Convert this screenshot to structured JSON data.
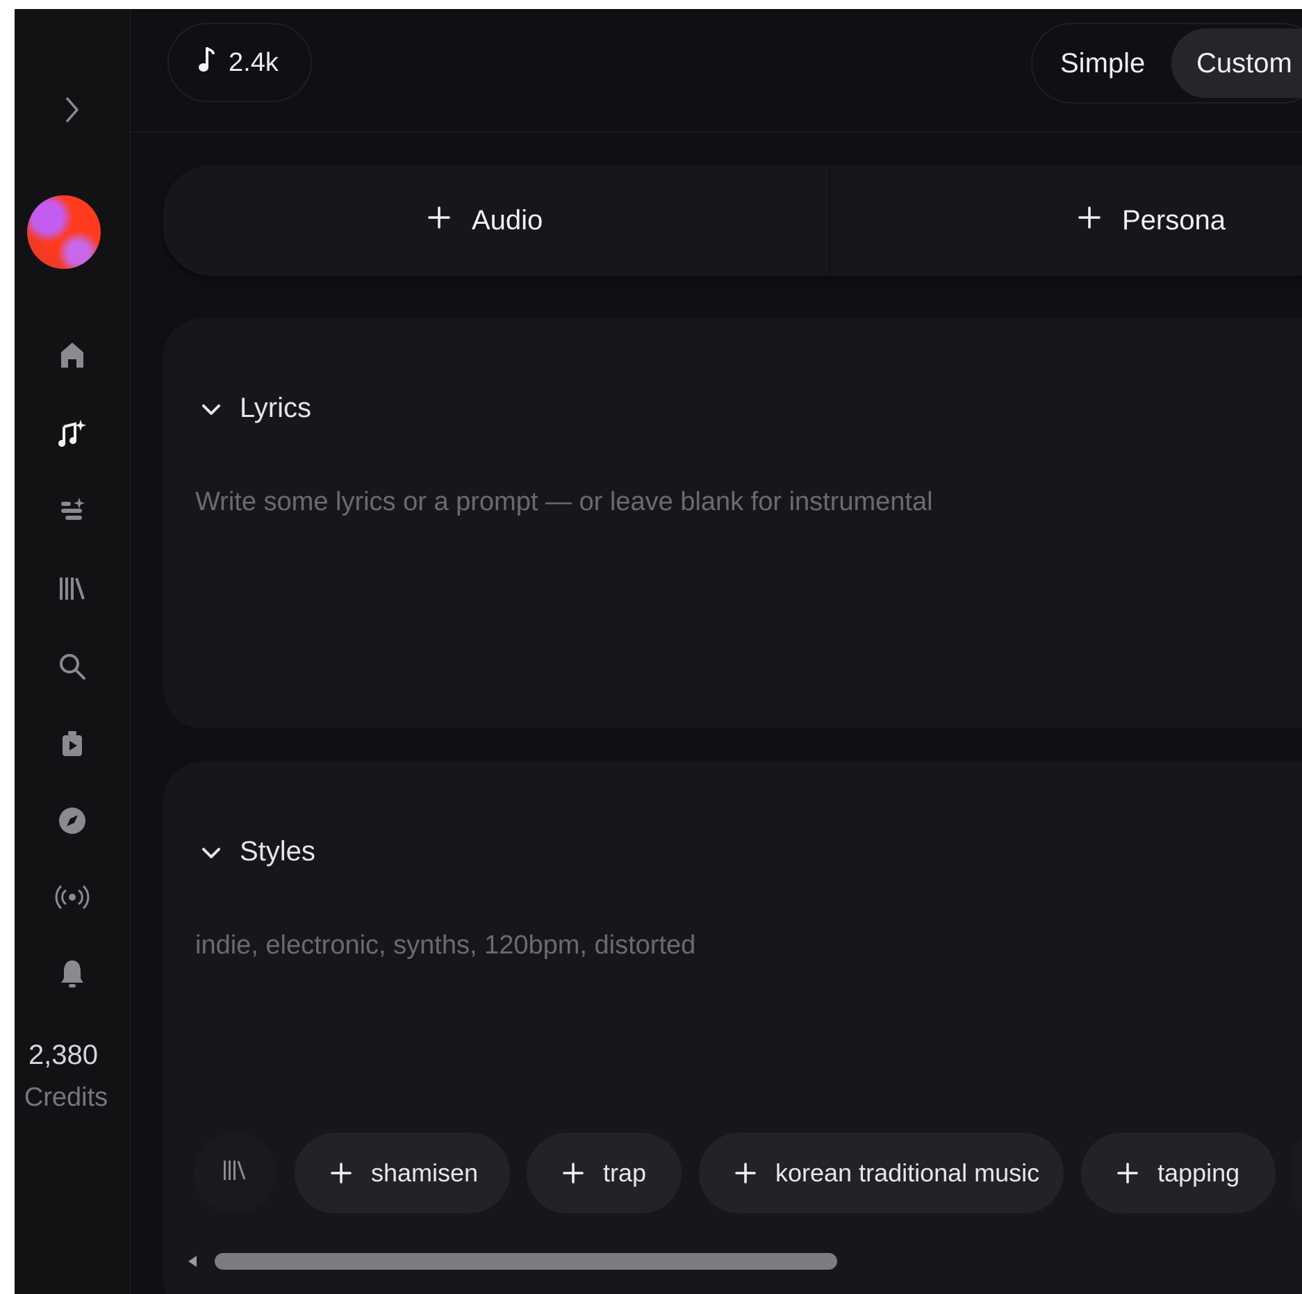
{
  "sidebar": {
    "expand_icon": "chevron-right-icon",
    "nav_icons": [
      "home-icon",
      "create-music-icon",
      "studio-icon",
      "library-icon",
      "search-icon",
      "video-icon",
      "explore-compass-icon",
      "radio-broadcast-icon",
      "notifications-bell-icon"
    ],
    "credits_value": "2,380",
    "credits_label": "Credits"
  },
  "topbar": {
    "songs_count": "2.4k",
    "mode_simple": "Simple",
    "mode_custom": "Custom",
    "selected_mode": "Custom"
  },
  "add_row": {
    "audio_label": "Audio",
    "persona_label": "Persona"
  },
  "lyrics": {
    "title": "Lyrics",
    "placeholder": "Write some lyrics or a prompt — or leave blank for instrumental"
  },
  "styles": {
    "title": "Styles",
    "placeholder": "indie, electronic, synths, 120bpm, distorted",
    "tags": [
      "shamisen",
      "trap",
      "korean traditional music",
      "tapping"
    ]
  },
  "colors": {
    "background": "#101014",
    "card": "#17171b",
    "chip": "#222227",
    "text": "#f0f0f2",
    "muted": "#6a6a72"
  }
}
